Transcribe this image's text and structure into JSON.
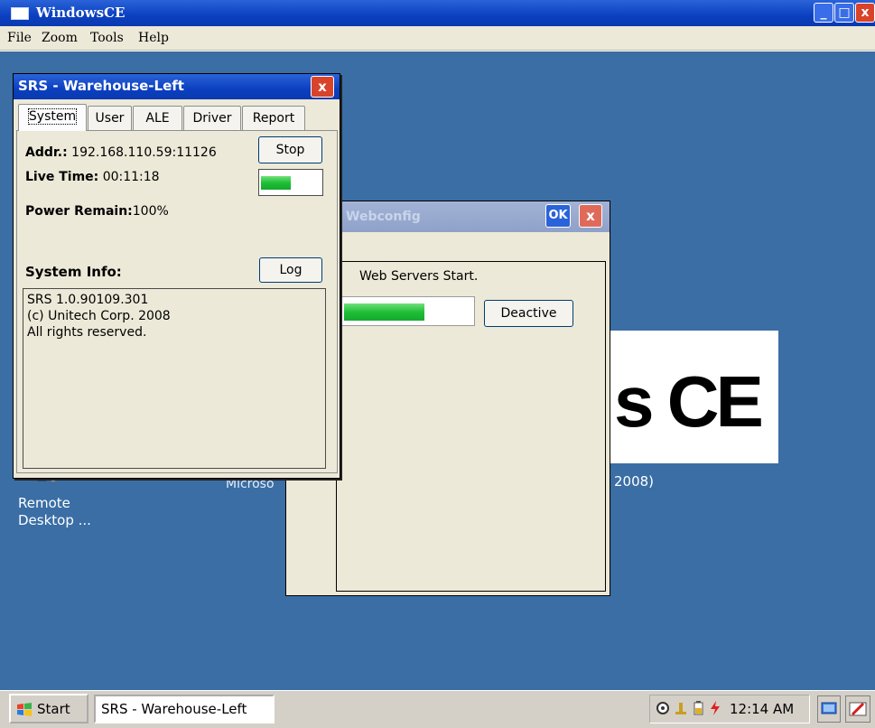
{
  "window": {
    "title": "WindowsCE",
    "controls": {
      "minimize": "_",
      "maximize": "□",
      "close": "x"
    }
  },
  "menubar": [
    "File",
    "Zoom",
    "Tools",
    "Help"
  ],
  "desktop": {
    "logo_text": "s CE",
    "caption_left": "Microso",
    "caption_right": "2008)",
    "remote_desktop_label": "Remote Desktop ..."
  },
  "webconfig": {
    "title": "Webconfig",
    "ok_label": "OK",
    "close_label": "x",
    "status_text": "Web Servers Start.",
    "progress_fraction": 0.62,
    "deactive_label": "Deactive"
  },
  "srs": {
    "title": "SRS - Warehouse-Left",
    "close_label": "x",
    "tabs": [
      "System",
      "User",
      "ALE",
      "Driver",
      "Report"
    ],
    "active_tab": "System",
    "addr_label": "Addr.:",
    "addr_value": "192.168.110.59:11126",
    "stop_label": "Stop",
    "livetime_label": "Live Time:",
    "livetime_value": "00:11:18",
    "livetime_progress_fraction": 0.5,
    "power_label": "Power Remain:",
    "power_value": "100%",
    "sysinfo_label": "System Info:",
    "log_label": "Log",
    "info_lines": [
      "SRS 1.0.90109.301",
      "(c) Unitech Corp. 2008",
      "All rights reserved."
    ]
  },
  "taskbar": {
    "start_label": "Start",
    "task_item": "SRS - Warehouse-Left",
    "clock": "12:14 AM"
  },
  "colors": {
    "titlebar_blue": "#0b3fc0",
    "desktop_blue": "#3a6ea5",
    "progress_green": "#1fbf37",
    "close_red": "#d8432a",
    "window_face": "#ece9d8"
  }
}
